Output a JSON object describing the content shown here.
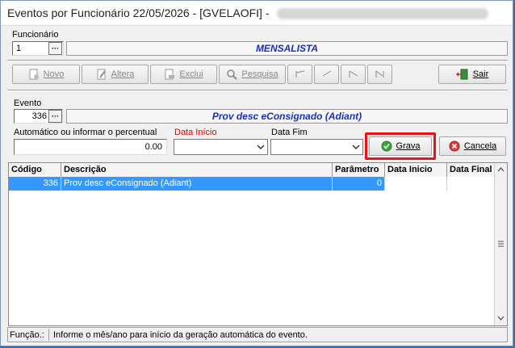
{
  "window": {
    "title": "Eventos por Funcionário 22/05/2026 - [GVELAOFI] -"
  },
  "funcionario": {
    "label": "Funcionário",
    "code": "1",
    "name": "MENSALISTA",
    "lookup_label": "···"
  },
  "toolbar": {
    "novo": "Novo",
    "altera": "Altera",
    "exclui": "Exclui",
    "pesquisa": "Pesquisa",
    "sair": "Sair"
  },
  "evento": {
    "label": "Evento",
    "code": "336",
    "description": "Prov desc eConsignado (Adiant)",
    "lookup_label": "···"
  },
  "form": {
    "valor_label": "Automático ou informar o percentual",
    "valor": "0.00",
    "data_inicio_label": "Data Início",
    "data_fim_label": "Data Fim",
    "grava": "Grava",
    "cancela": "Cancela"
  },
  "colors": {
    "data_inicio_label": "#e00000",
    "banner_text": "#1a2fb8",
    "highlight_frame": "#e8121b",
    "selected_row": "#3399ff"
  },
  "grid": {
    "columns": [
      "Código",
      "Descrição",
      "Parâmetro",
      "Data Inicio",
      "Data Final"
    ],
    "rows": [
      {
        "codigo": "336",
        "descricao": "Prov desc eConsignado (Adiant)",
        "parametro": "0",
        "data_inicio": "",
        "data_final": ""
      }
    ]
  },
  "status": {
    "label": "Função.:",
    "text": "Informe o mês/ano para início da geração automática do evento."
  }
}
